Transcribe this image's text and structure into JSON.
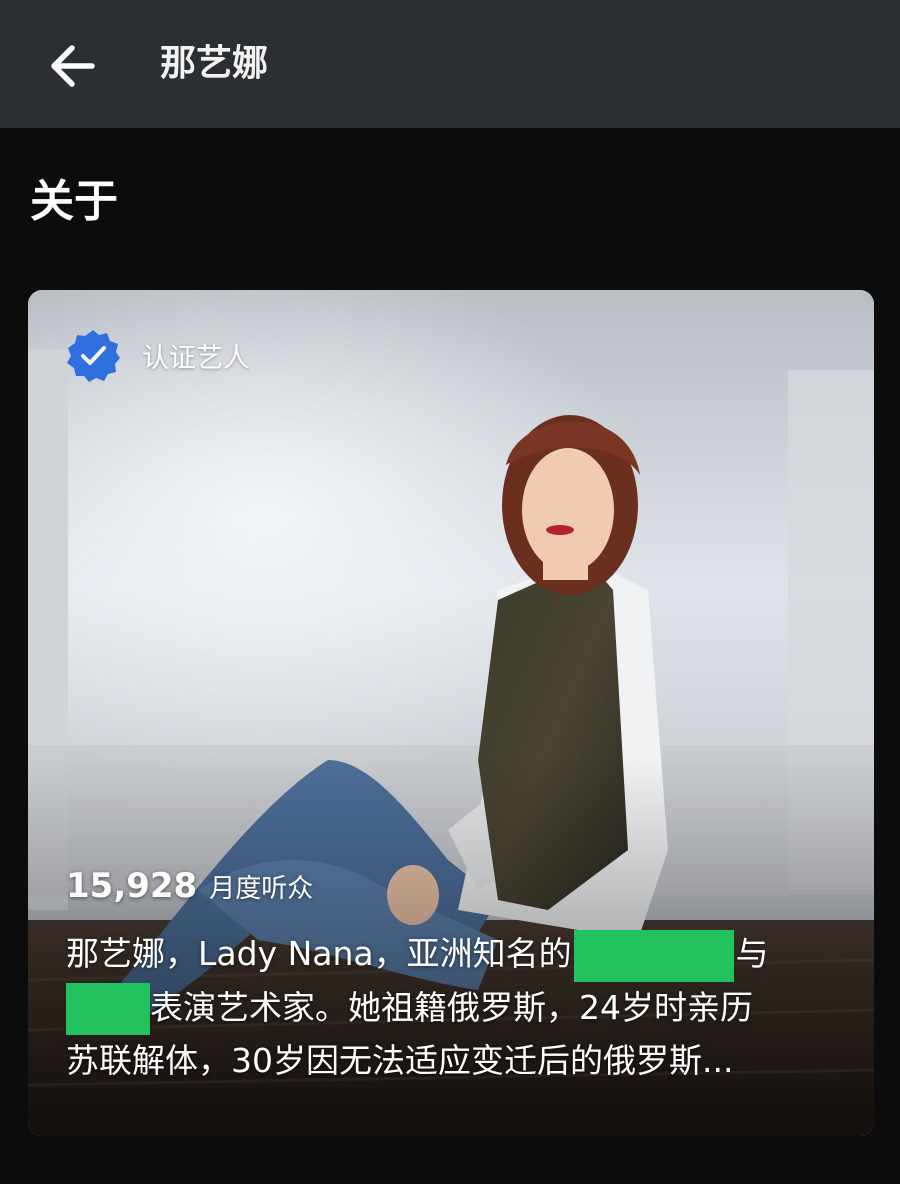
{
  "header": {
    "title": "那艺娜",
    "back_icon": "arrow-left-icon"
  },
  "section": {
    "title": "关于"
  },
  "artist_card": {
    "verified_icon": "verified-badge-icon",
    "verified_label": "认证艺人",
    "listeners_count": "15,928",
    "listeners_label": "月度听众",
    "bio": {
      "part1": "那艺娜，Lady Nana，亚洲知名的",
      "part2": "与",
      "part3": "表演艺术家。她祖籍俄罗斯，24岁时亲历",
      "part4": "苏联解体，30岁因无法适应变迁后的俄罗斯..."
    },
    "colors": {
      "badge_blue": "#2f6fe0",
      "redaction_green": "#22c35e"
    }
  }
}
